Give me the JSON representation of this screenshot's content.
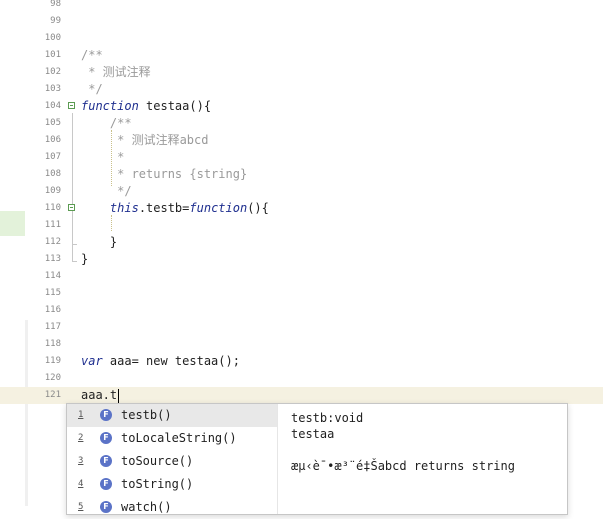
{
  "editor": {
    "lines": [
      {
        "n": "98",
        "text": ""
      },
      {
        "n": "99",
        "text": ""
      },
      {
        "n": "100",
        "text": ""
      },
      {
        "n": "101",
        "comment": "/**"
      },
      {
        "n": "102",
        "comment": " * 测试注释"
      },
      {
        "n": "103",
        "comment": " */"
      },
      {
        "n": "104",
        "kw": "function",
        "rest": " testaa(){"
      },
      {
        "n": "105",
        "comment": "    /**"
      },
      {
        "n": "106",
        "comment": "     * 测试注释abcd"
      },
      {
        "n": "107",
        "comment": "     *"
      },
      {
        "n": "108",
        "comment": "     * returns {string}"
      },
      {
        "n": "109",
        "comment": "     */"
      },
      {
        "n": "110",
        "pre": "    ",
        "kw": "this",
        "mid": ".testb=",
        "kw2": "function",
        "rest": "(){"
      },
      {
        "n": "111",
        "text": ""
      },
      {
        "n": "112",
        "text": "    }"
      },
      {
        "n": "113",
        "text": "}"
      },
      {
        "n": "114",
        "text": ""
      },
      {
        "n": "115",
        "text": ""
      },
      {
        "n": "116",
        "text": ""
      },
      {
        "n": "117",
        "text": ""
      },
      {
        "n": "118",
        "text": ""
      },
      {
        "n": "119",
        "kw": "var",
        "rest": " aaa= new testaa();"
      },
      {
        "n": "120",
        "text": ""
      },
      {
        "n": "121",
        "text": "aaa.t"
      }
    ]
  },
  "autocomplete": {
    "items": [
      {
        "num": "1",
        "icon": "F",
        "label": "testb()"
      },
      {
        "num": "2",
        "icon": "F",
        "label": "toLocaleString()"
      },
      {
        "num": "3",
        "icon": "F",
        "label": "toSource()"
      },
      {
        "num": "4",
        "icon": "F",
        "label": "toString()"
      },
      {
        "num": "5",
        "icon": "F",
        "label": "watch()"
      }
    ],
    "detail": {
      "signature": "testb:void",
      "owner": "testaa",
      "doc": "æµ‹è¯•æ³¨é‡Šabcd returns string"
    }
  }
}
